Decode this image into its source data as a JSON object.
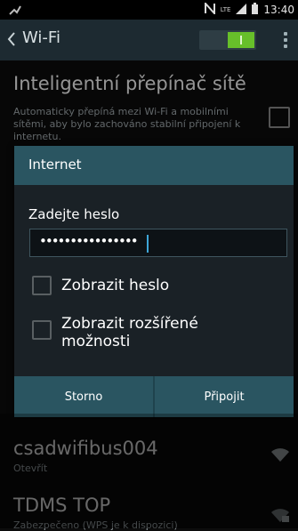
{
  "status_bar": {
    "time": "13:40",
    "network": "LTE"
  },
  "action_bar": {
    "title": "Wi-Fi",
    "wifi_toggle": "on"
  },
  "smart_switch": {
    "title": "Inteligentní přepínač sítě",
    "description": "Automaticky přepíná mezi Wi-Fi a mobilními sítěmi, aby bylo zachováno stabilní připojení k internetu."
  },
  "networks": [
    {
      "name": "csadwifibus004",
      "status": "Otevřít"
    },
    {
      "name": "TDMS TOP",
      "status": "Zabezpečeno (WPS je k dispozici)"
    }
  ],
  "dialog": {
    "title": "Internet",
    "password_label": "Zadejte heslo",
    "password_value": "••••••••••••••••",
    "show_password": "Zobrazit heslo",
    "show_advanced": "Zobrazit rozšířené možnosti",
    "cancel": "Storno",
    "connect": "Připojit"
  }
}
